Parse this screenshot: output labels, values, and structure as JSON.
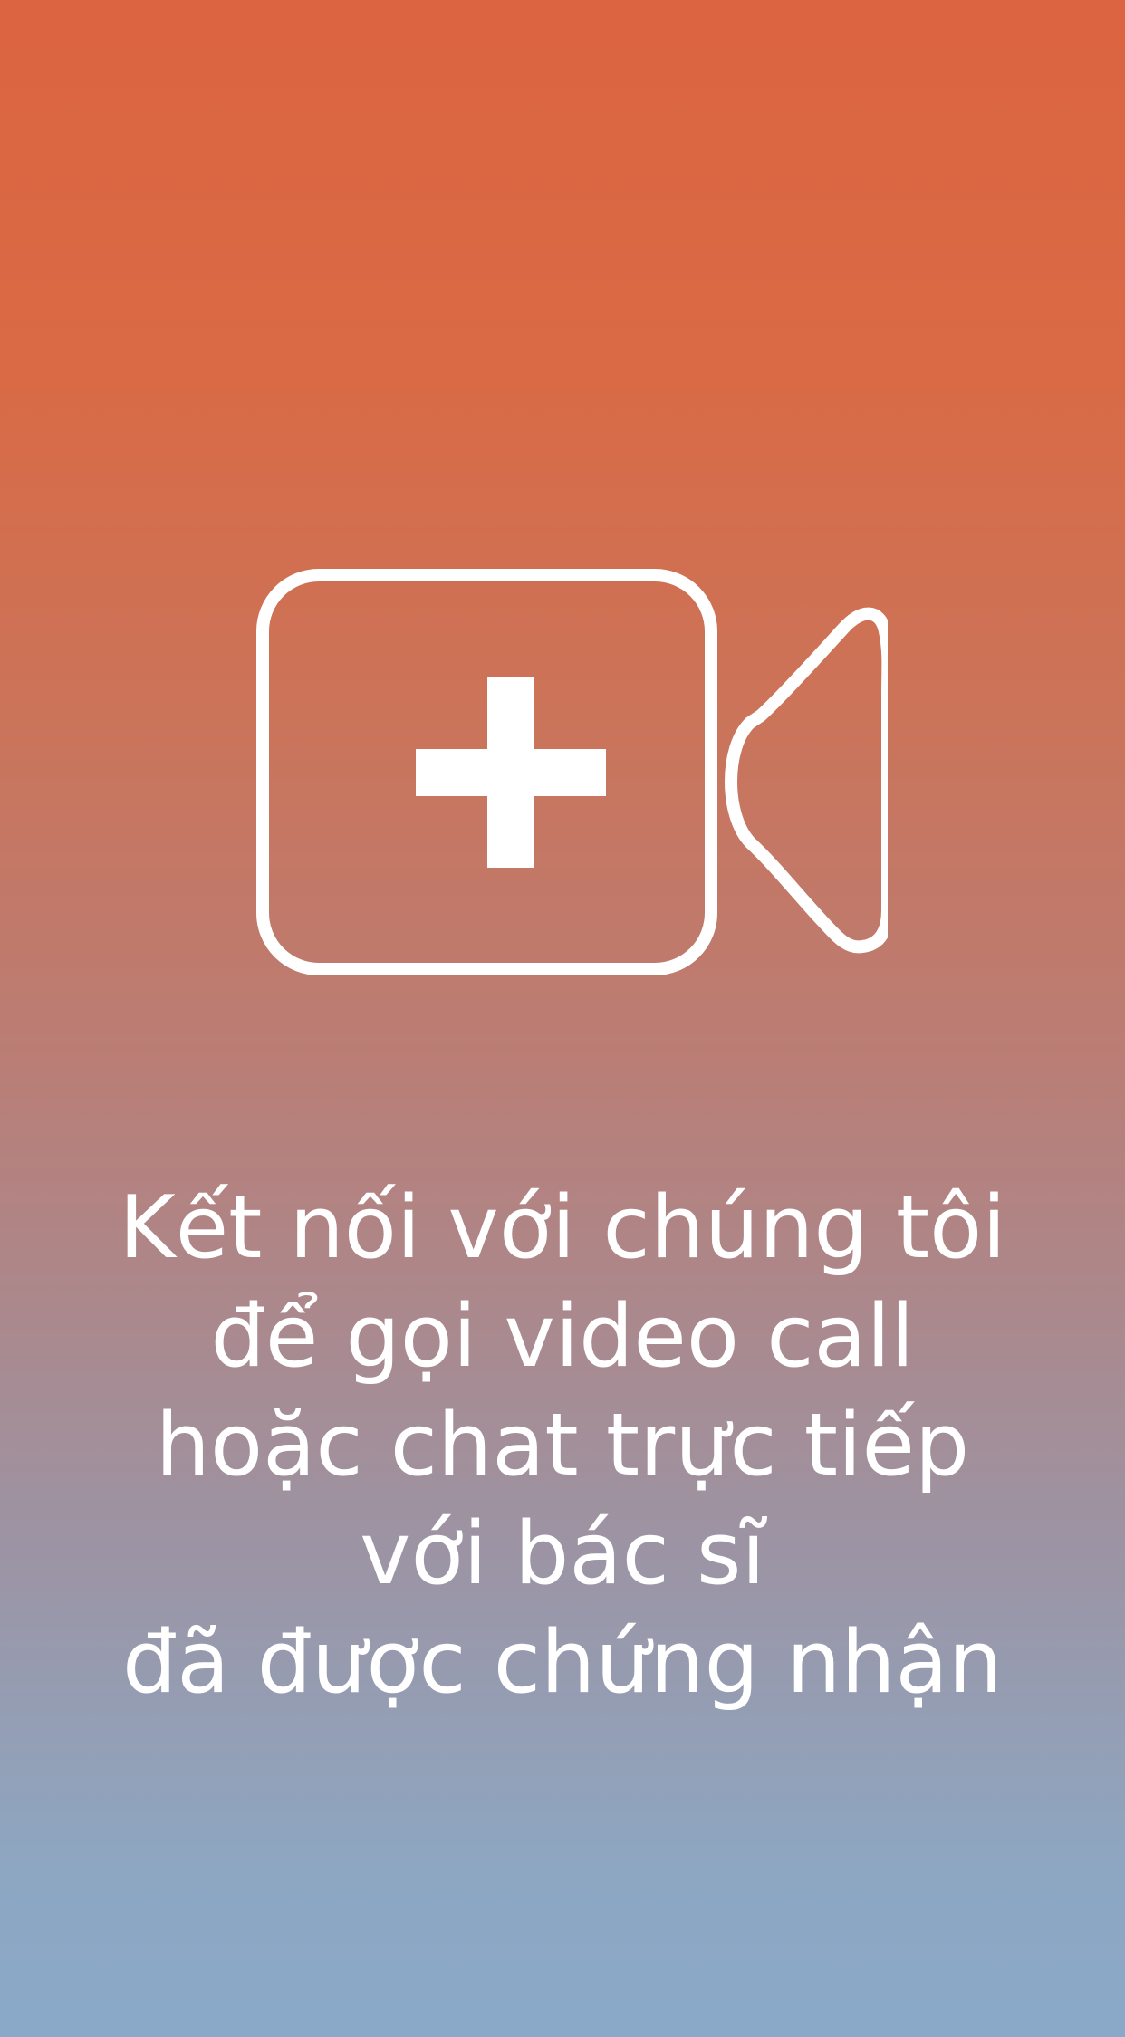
{
  "icon": {
    "name": "video-call-medical-icon",
    "stroke_color": "#ffffff"
  },
  "message": {
    "lines": [
      "Kết nối với chúng tôi",
      "để gọi video call",
      "hoặc chat trực tiếp",
      "với bác sĩ",
      "đã được chứng nhận"
    ]
  },
  "colors": {
    "gradient_top": "#dc6440",
    "gradient_bottom": "#8aa8c9",
    "text": "#ffffff"
  }
}
